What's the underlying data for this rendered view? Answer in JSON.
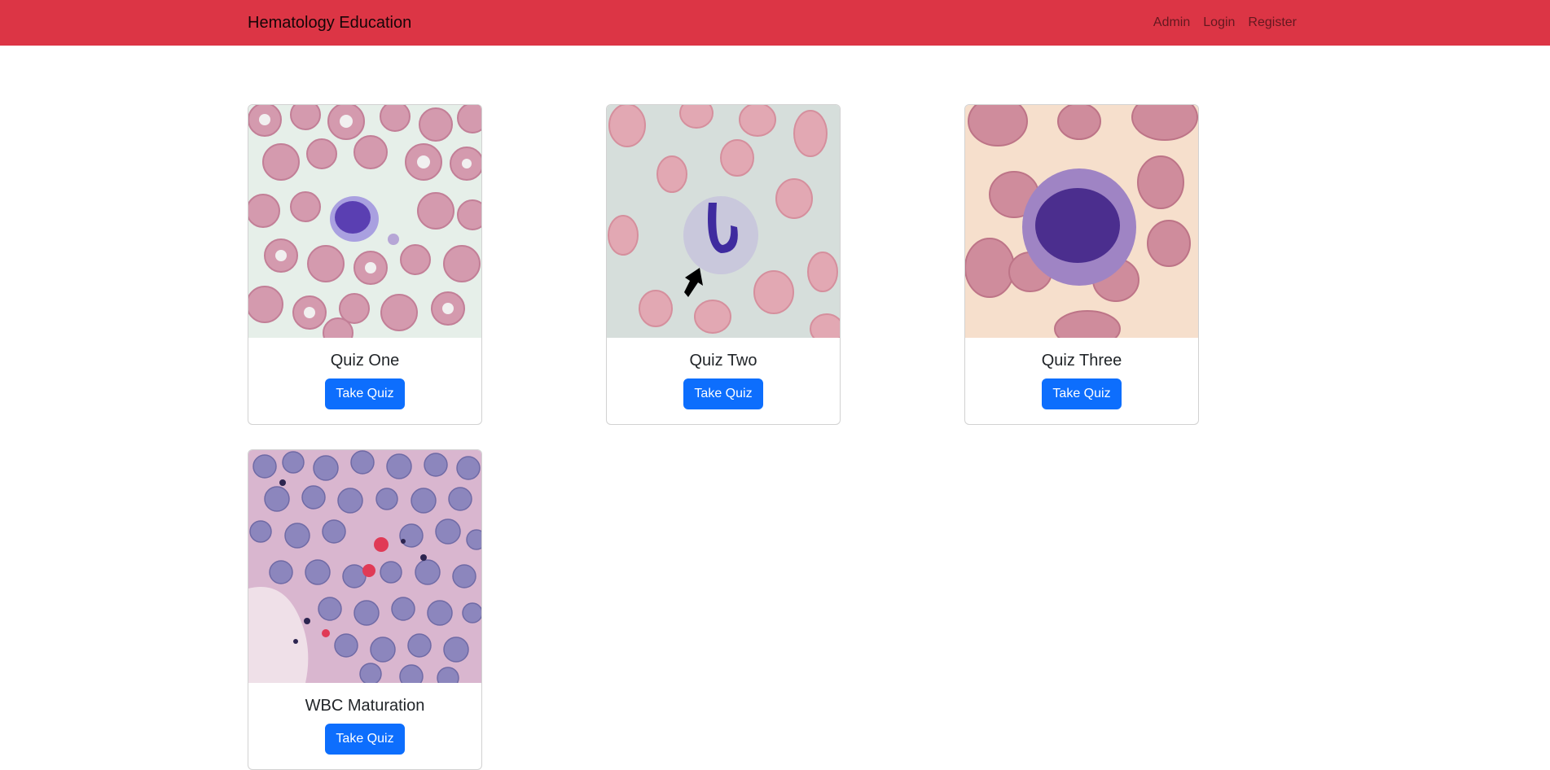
{
  "navbar": {
    "brand": "Hematology Education",
    "links": [
      "Admin",
      "Login",
      "Register"
    ],
    "color": "#dc3545"
  },
  "quizzes": [
    {
      "title": "Quiz One",
      "button": "Take Quiz",
      "image": "blood-smear-cell-image"
    },
    {
      "title": "Quiz Two",
      "button": "Take Quiz",
      "image": "blood-smear-band-cell-arrow-image"
    },
    {
      "title": "Quiz Three",
      "button": "Take Quiz",
      "image": "blood-smear-cell-image"
    },
    {
      "title": "WBC Maturation",
      "button": "Take Quiz",
      "image": "bone-marrow-tissue-image"
    }
  ],
  "accent_color": "#0d6efd"
}
